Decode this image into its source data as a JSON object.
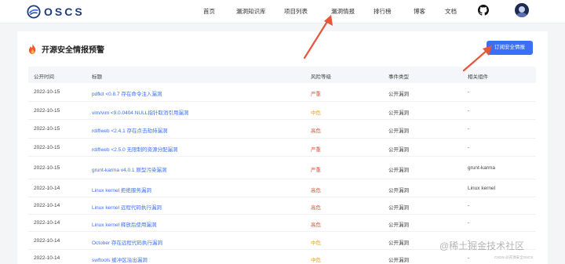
{
  "brand": {
    "name": "OSCS"
  },
  "nav": {
    "items": [
      {
        "label": "首页"
      },
      {
        "label": "漏洞知识库"
      },
      {
        "label": "项目列表"
      },
      {
        "label": "漏洞情报"
      },
      {
        "label": "排行榜"
      },
      {
        "label": "博客"
      },
      {
        "label": "文档"
      }
    ],
    "github_icon": "github-icon",
    "avatar_icon": "user-avatar"
  },
  "page": {
    "title": "开源安全情报预警",
    "title_icon": "flame-icon",
    "subscribe_label": "订阅安全情报"
  },
  "table": {
    "columns": [
      "公开时间",
      "标题",
      "风险等级",
      "事件类型",
      "相关组件"
    ],
    "rows": [
      {
        "date": "2022-10-15",
        "title": "pdfkit <0.8.7 存在命令注入漏洞",
        "severity": "严重",
        "sev_class": "sev-high-critical",
        "type": "公开漏洞",
        "component": "-"
      },
      {
        "date": "2022-10-15",
        "title": "vim/vim <9.0.0404 NULL指针取消引用漏洞",
        "severity": "中危",
        "sev_class": "sev-mid",
        "type": "公开漏洞",
        "component": "-"
      },
      {
        "date": "2022-10-15",
        "title": "rdiffweb <2.4.1 存在点击劫持漏洞",
        "severity": "高危",
        "sev_class": "sev-high",
        "type": "公开漏洞",
        "component": "-"
      },
      {
        "date": "2022-10-15",
        "title": "rdiffweb <2.5.0 无限制的资源分配漏洞",
        "severity": "严重",
        "sev_class": "sev-high-critical",
        "type": "公开漏洞",
        "component": "-"
      },
      {
        "date": "2022-10-15",
        "title": "grunt-karma v4.0.1 原型污染漏洞",
        "severity": "严重",
        "sev_class": "sev-high-critical",
        "type": "公开漏洞",
        "component": "grunt-karma"
      },
      {
        "date": "2022-10-14",
        "title": "Linux kernel 拒绝服务漏洞",
        "severity": "高危",
        "sev_class": "sev-high",
        "type": "公开漏洞",
        "component": "Linux kernel"
      },
      {
        "date": "2022-10-14",
        "title": "Linux kernel 远程代码执行漏洞",
        "severity": "高危",
        "sev_class": "sev-high",
        "type": "公开漏洞",
        "component": "-"
      },
      {
        "date": "2022-10-14",
        "title": "Linux kernel 释放后使用漏洞",
        "severity": "高危",
        "sev_class": "sev-high",
        "type": "公开漏洞",
        "component": "-"
      },
      {
        "date": "2022-10-14",
        "title": "October 存在远程代码执行漏洞",
        "severity": "中危",
        "sev_class": "sev-mid",
        "type": "公开漏洞",
        "component": "-"
      },
      {
        "date": "2022-10-14",
        "title": "swftools 缓冲区溢出漏洞",
        "severity": "中危",
        "sev_class": "sev-mid",
        "type": "公开漏洞",
        "component": "-"
      }
    ]
  },
  "watermark": {
    "text": "@稀土掘金技术社区",
    "small": "CSDN @开源安全OSCS"
  },
  "colors": {
    "accent": "#3b6ff5",
    "critical": "#e2503c",
    "medium": "#f0a020",
    "annotation_arrow": "#e8553a"
  }
}
